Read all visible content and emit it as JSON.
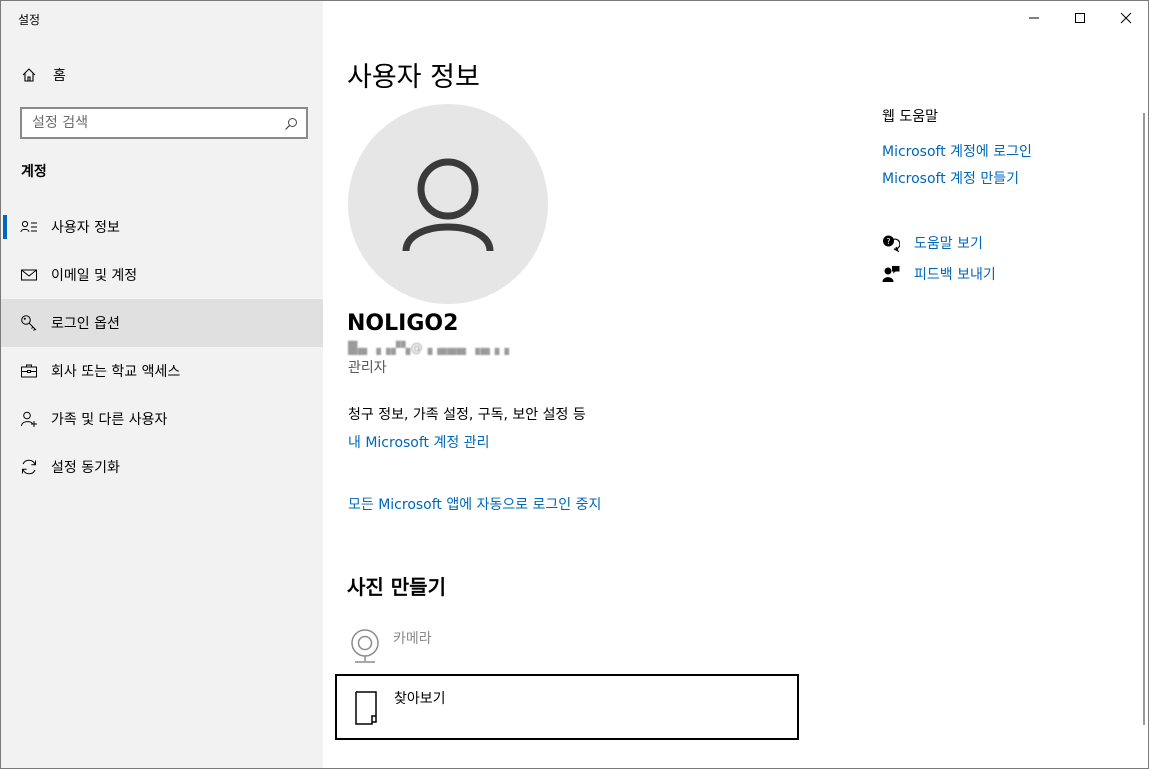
{
  "window": {
    "title": "설정"
  },
  "sidebar": {
    "home_label": "홈",
    "search_placeholder": "설정 검색",
    "section_title": "계정",
    "items": [
      {
        "label": "사용자 정보",
        "icon": "user-info-icon",
        "selected_indicator": true
      },
      {
        "label": "이메일 및 계정",
        "icon": "mail-icon"
      },
      {
        "label": "로그인 옵션",
        "icon": "key-icon",
        "highlighted": true
      },
      {
        "label": "회사 또는 학교 액세스",
        "icon": "briefcase-icon"
      },
      {
        "label": "가족 및 다른 사용자",
        "icon": "add-person-icon"
      },
      {
        "label": "설정 동기화",
        "icon": "sync-icon"
      }
    ]
  },
  "main": {
    "title": "사용자 정보",
    "user": {
      "name": "NOLIGO2",
      "email": "█▄ ▗▗▞▚@▗ ▄▄▄ ▗▄▗▗",
      "role": "관리자"
    },
    "billing_text": "청구 정보, 가족 설정, 구독, 보안 설정 등",
    "manage_link": "내 Microsoft 계정 관리",
    "stop_signin_link": "모든 Microsoft 앱에 자동으로 로그인 중지",
    "photo_title": "사진 만들기",
    "camera_label": "카메라",
    "browse_label": "찾아보기"
  },
  "aside": {
    "web_help_title": "웹 도움말",
    "links": [
      "Microsoft 계정에 로그인",
      "Microsoft 계정 만들기"
    ],
    "get_help": "도움말 보기",
    "feedback": "피드백 보내기"
  },
  "colors": {
    "accent": "#0067b8",
    "sidebar_bg": "#f2f2f2",
    "selected_bg": "#e0e0e0",
    "avatar_bg": "#e6e6e6"
  }
}
